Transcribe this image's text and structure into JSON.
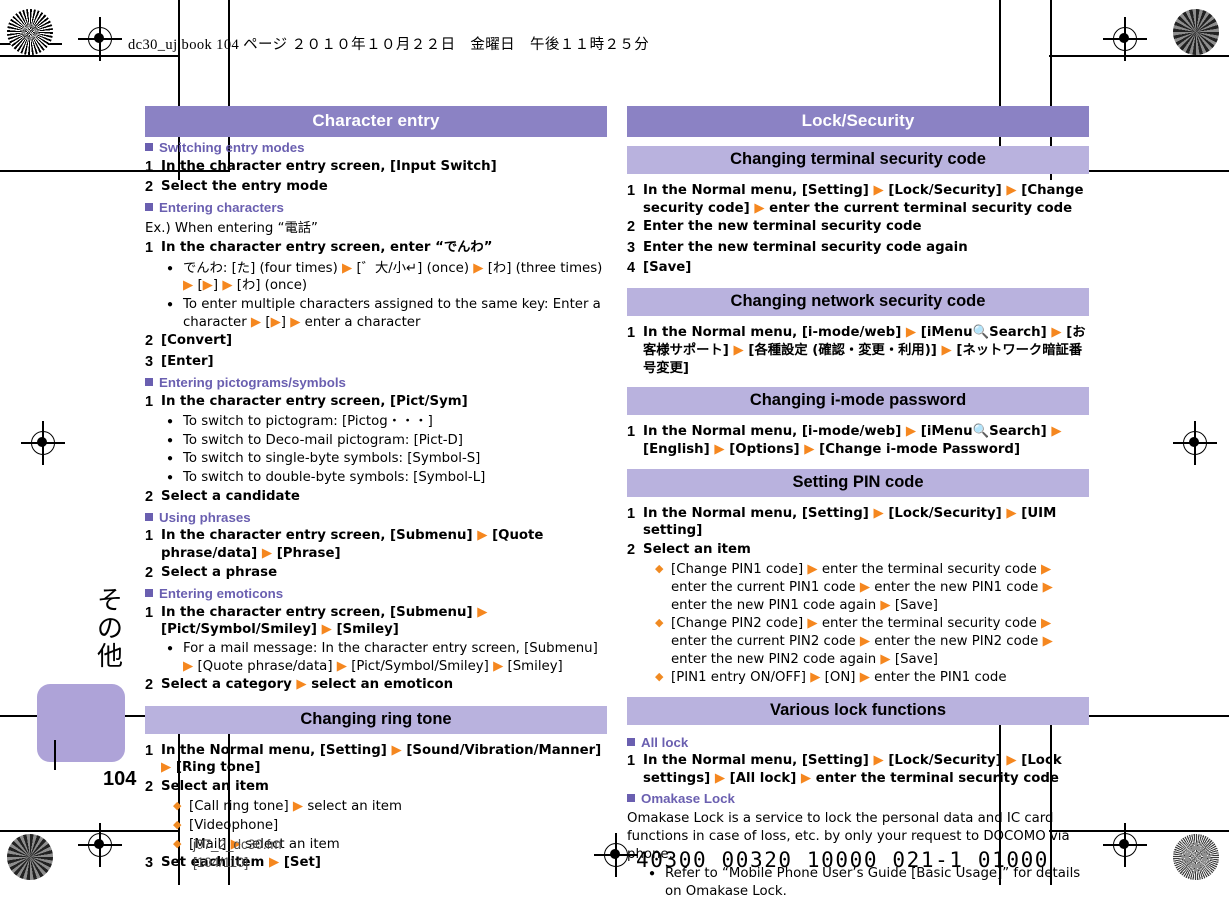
{
  "page": {
    "header_line": "dc30_uj.book   104 ページ   ２０１０年１０月２２日　金曜日　午後１１時２５分",
    "page_number": "104",
    "file_name": "j07_2_dc30.fm",
    "file_pages": "[104/110]",
    "barcode_text": "40300 00320 10000 021-1 01000",
    "side_tab_text": "その他",
    "colors": {
      "band_main": "#8b82c4",
      "band_sub": "#b9b2de",
      "heading_purple": "#6a5fb0",
      "arrow_orange": "#f5871f",
      "tab_purple": "#aea3d8"
    }
  },
  "left_column": {
    "title": "Character entry",
    "blocks": [
      {
        "kind": "sect",
        "text": "Switching entry modes"
      },
      {
        "kind": "step",
        "n": "1",
        "text": "In the character entry screen, [Input Switch]"
      },
      {
        "kind": "step",
        "n": "2",
        "text": "Select the entry mode"
      },
      {
        "kind": "sect",
        "text": "Entering characters"
      },
      {
        "kind": "plain",
        "text": "Ex.) When entering “電話”"
      },
      {
        "kind": "step",
        "n": "1",
        "text": "In the character entry screen, enter “でんわ”"
      },
      {
        "kind": "bul",
        "text": "でんわ: [た] (four times) ▶ [゛大/小↵] (once) ▶ [わ] (three times) ▶ [▶] ▶ [わ] (once)"
      },
      {
        "kind": "bul",
        "text": "To enter multiple characters assigned to the same key: Enter a character ▶ [▶] ▶ enter a character"
      },
      {
        "kind": "step",
        "n": "2",
        "text": "[Convert]"
      },
      {
        "kind": "step",
        "n": "3",
        "text": "[Enter]"
      },
      {
        "kind": "sect",
        "text": "Entering pictograms/symbols"
      },
      {
        "kind": "step",
        "n": "1",
        "text": "In the character entry screen, [Pict/Sym]"
      },
      {
        "kind": "bul",
        "text": "To switch to pictogram: [Pictog・・・]"
      },
      {
        "kind": "bul",
        "text": "To switch to Deco-mail pictogram: [Pict-D]"
      },
      {
        "kind": "bul",
        "text": "To switch to single-byte symbols: [Symbol-S]"
      },
      {
        "kind": "bul",
        "text": "To switch to double-byte symbols: [Symbol-L]"
      },
      {
        "kind": "step",
        "n": "2",
        "text": "Select a candidate"
      },
      {
        "kind": "sect",
        "text": "Using phrases"
      },
      {
        "kind": "step",
        "n": "1",
        "text": "In the character entry screen, [Submenu] ▶ [Quote phrase/data] ▶ [Phrase]"
      },
      {
        "kind": "step",
        "n": "2",
        "text": "Select a phrase"
      },
      {
        "kind": "sect",
        "text": "Entering emoticons"
      },
      {
        "kind": "step",
        "n": "1",
        "text": "In the character entry screen, [Submenu] ▶ [Pict/Symbol/Smiley] ▶ [Smiley]"
      },
      {
        "kind": "bul",
        "text": "For a mail message: In the character entry screen, [Submenu] ▶ [Quote phrase/data] ▶ [Pict/Symbol/Smiley] ▶ [Smiley]"
      },
      {
        "kind": "step",
        "n": "2",
        "text": "Select a category ▶ select an emoticon"
      },
      {
        "kind": "bandsub",
        "text": "Changing ring tone"
      },
      {
        "kind": "step",
        "n": "1",
        "text": "In the Normal menu, [Setting] ▶ [Sound/Vibration/Manner] ▶ [Ring tone]"
      },
      {
        "kind": "step",
        "n": "2",
        "text": "Select an item"
      },
      {
        "kind": "dia",
        "text": "[Call ring tone] ▶ select an item"
      },
      {
        "kind": "dia",
        "text": "[Videophone]"
      },
      {
        "kind": "dia",
        "text": "[Mail] ▶ select an item"
      },
      {
        "kind": "step",
        "n": "3",
        "text": "Set each item ▶ [Set]"
      }
    ]
  },
  "right_column": {
    "title": "Lock/Security",
    "blocks": [
      {
        "kind": "bandsub",
        "text": "Changing terminal security code"
      },
      {
        "kind": "step",
        "n": "1",
        "text": "In the Normal menu, [Setting] ▶ [Lock/Security] ▶ [Change security code] ▶ enter the current terminal security code"
      },
      {
        "kind": "step",
        "n": "2",
        "text": "Enter the new terminal security code"
      },
      {
        "kind": "step",
        "n": "3",
        "text": "Enter the new terminal security code again"
      },
      {
        "kind": "step",
        "n": "4",
        "text": "[Save]"
      },
      {
        "kind": "bandsub",
        "text": "Changing network security code"
      },
      {
        "kind": "step",
        "n": "1",
        "text": "In the Normal menu, [i-mode/web] ▶ [iMenu🔍Search] ▶ [お客様サポート] ▶ [各種設定 (確認・変更・利用)] ▶ [ネットワーク暗証番号変更]"
      },
      {
        "kind": "bandsub",
        "text": "Changing i-mode password"
      },
      {
        "kind": "step",
        "n": "1",
        "text": "In the Normal menu, [i-mode/web] ▶ [iMenu🔍Search] ▶ [English] ▶ [Options] ▶ [Change i-mode Password]"
      },
      {
        "kind": "bandsub",
        "text": "Setting PIN code"
      },
      {
        "kind": "step",
        "n": "1",
        "text": "In the Normal menu, [Setting] ▶ [Lock/Security] ▶ [UIM setting]"
      },
      {
        "kind": "step",
        "n": "2",
        "text": "Select an item"
      },
      {
        "kind": "dia",
        "text": "[Change PIN1 code] ▶ enter the terminal security code ▶ enter the current PIN1 code ▶ enter the new PIN1 code ▶ enter the new PIN1 code again ▶ [Save]"
      },
      {
        "kind": "dia",
        "text": "[Change PIN2 code] ▶ enter the terminal security code ▶ enter the current PIN2 code ▶ enter the new PIN2 code ▶ enter the new PIN2 code again ▶ [Save]"
      },
      {
        "kind": "dia",
        "text": "[PIN1 entry ON/OFF] ▶ [ON] ▶ enter the PIN1 code"
      },
      {
        "kind": "bandsub",
        "text": "Various lock functions"
      },
      {
        "kind": "sect",
        "text": "All lock"
      },
      {
        "kind": "step",
        "n": "1",
        "text": "In the Normal menu, [Setting] ▶ [Lock/Security] ▶ [Lock settings] ▶ [All lock] ▶ enter the terminal security code"
      },
      {
        "kind": "sect",
        "text": "Omakase Lock"
      },
      {
        "kind": "plain",
        "text": "Omakase Lock is a service to lock the personal data and IC card functions in case of loss, etc. by only your request to DOCOMO via phone."
      },
      {
        "kind": "bul",
        "text": "Refer to “Mobile Phone User’s Guide [Basic Usage]” for details on Omakase Lock."
      }
    ]
  }
}
